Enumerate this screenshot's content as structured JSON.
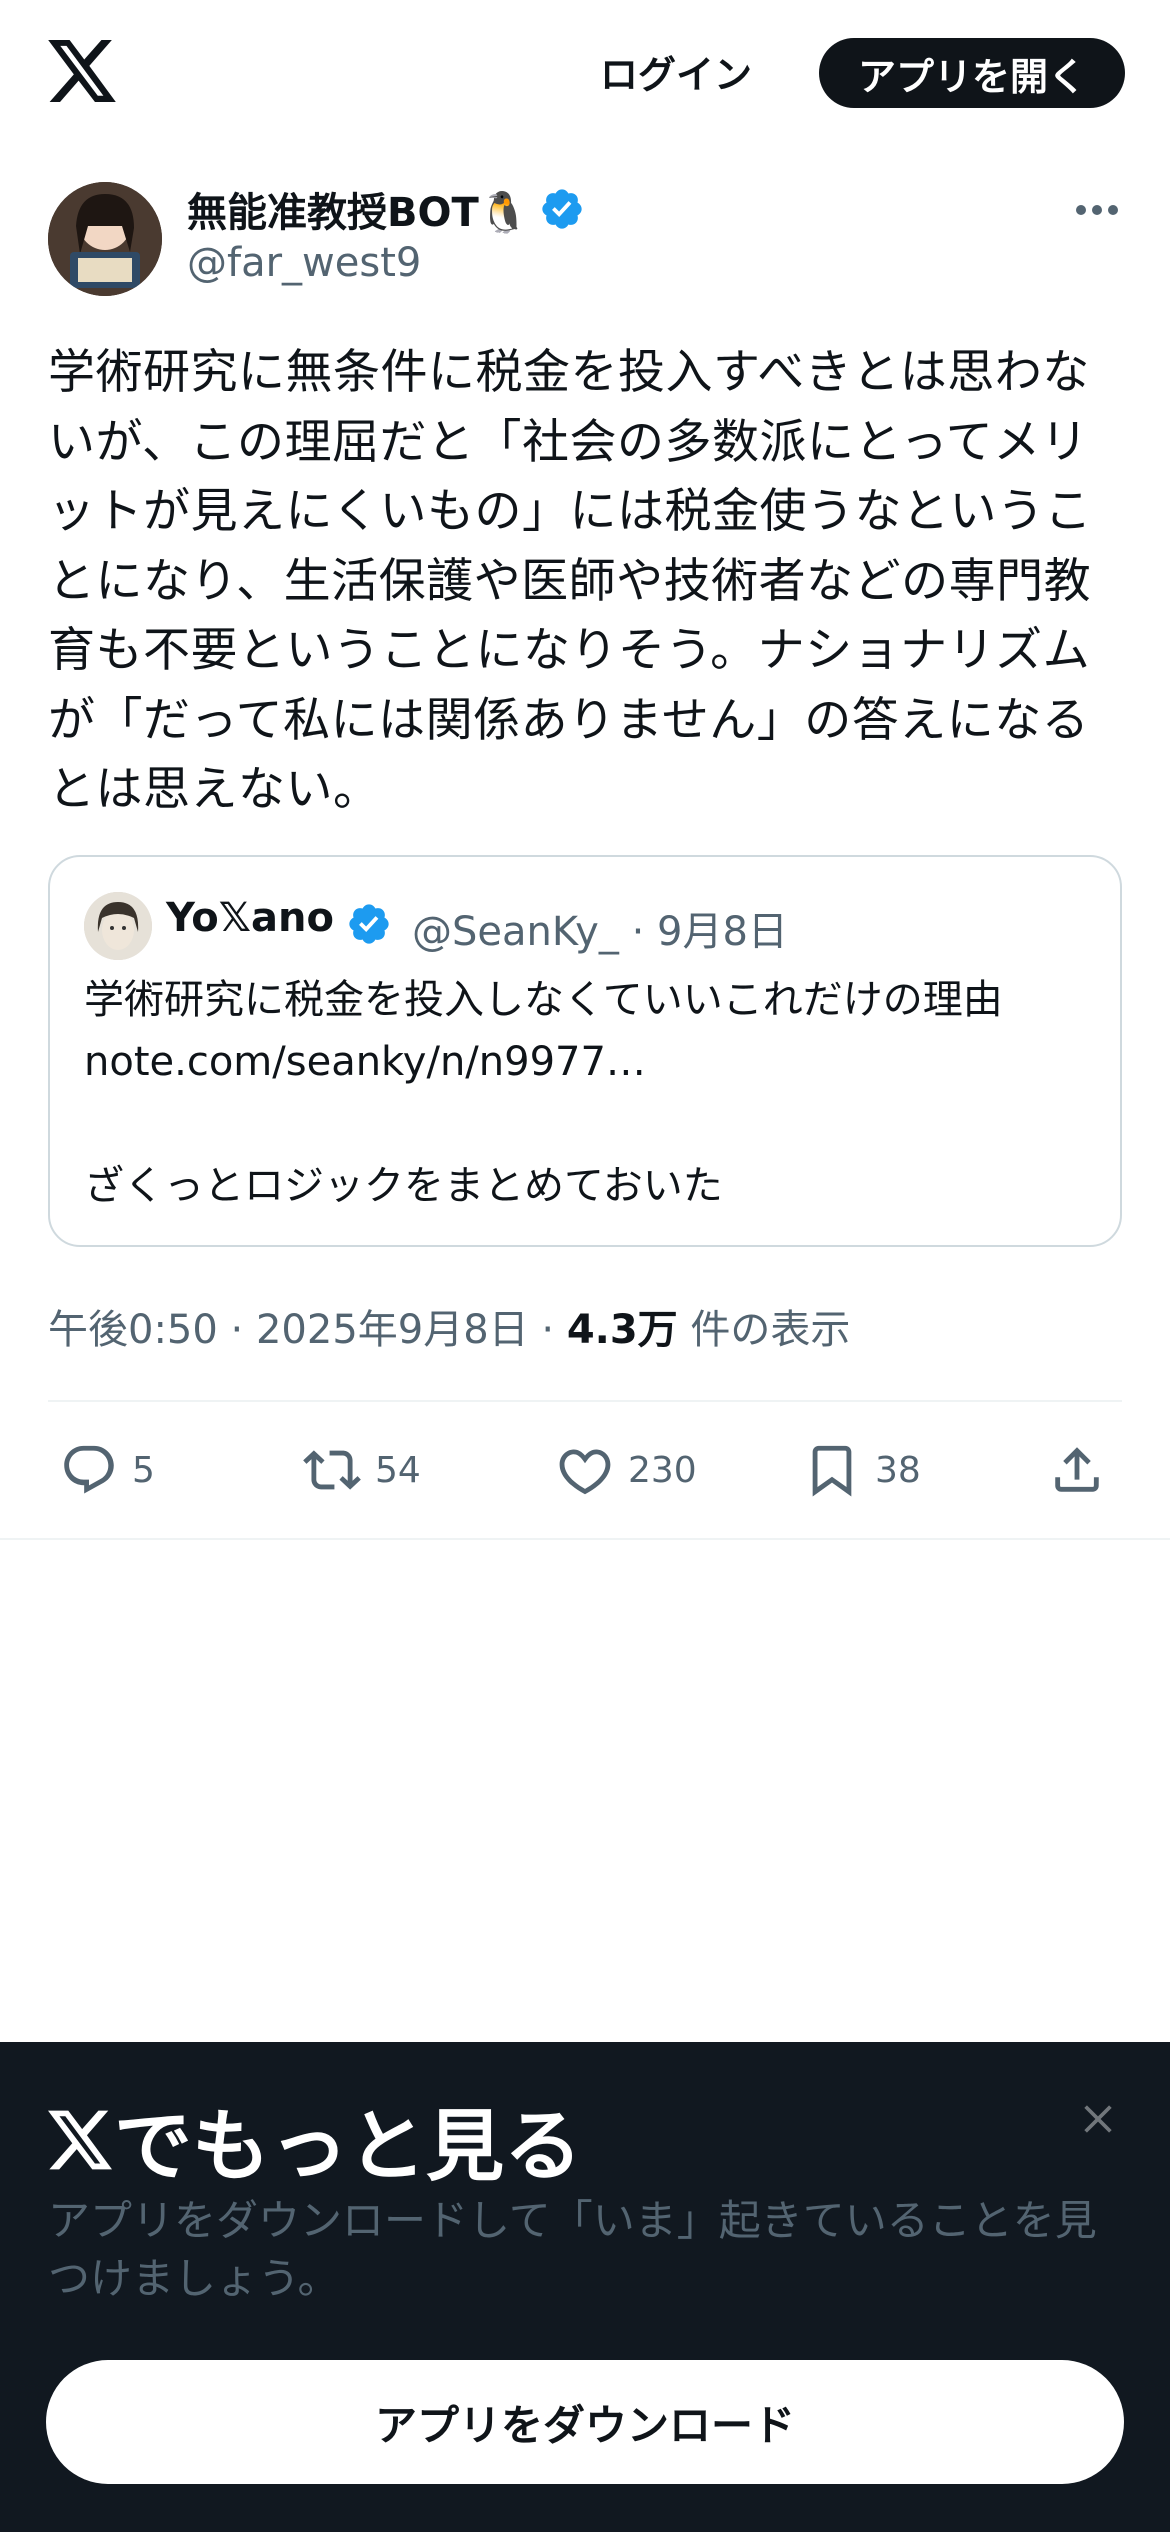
{
  "header": {
    "login_label": "ログイン",
    "open_app_label": "アプリを開く"
  },
  "tweet": {
    "author_name": "無能准教授BOT🐧",
    "author_handle": "@far_west9",
    "text": "学術研究に無条件に税金を投入すべきとは思わないが、この理屈だと「社会の多数派にとってメリットが見えにくいもの」には税金使うなということになり、生活保護や医師や技術者などの専門教育も不要ということになりそう。ナショナリズムが「だって私には関係ありません」の答えになるとは思えない。",
    "quote": {
      "author_name": "Yo𝕏ano",
      "author_handle": "@SeanKy_",
      "date": "· 9月8日",
      "lines": [
        "学術研究に税金を投入しなくていいこれだけの理由",
        "note.com/seanky/n/n9977…",
        "",
        "ざくっとロジックをまとめておいた"
      ]
    },
    "time": "午後0:50 · 2025年9月8日 · ",
    "views_count": "4.3万",
    "views_label": " 件の表示",
    "stats": {
      "replies": "5",
      "retweets": "54",
      "likes": "230",
      "bookmarks": "38"
    }
  },
  "sheet": {
    "title": "でもっと見る",
    "description": "アプリをダウンロードして「いま」起きていることを見つけましょう。",
    "button_label": "アプリをダウンロード"
  },
  "colors": {
    "text_primary": "#0f1419",
    "text_secondary": "#536471",
    "verified_blue": "#1d9bf0",
    "sheet_bg": "#111820"
  }
}
